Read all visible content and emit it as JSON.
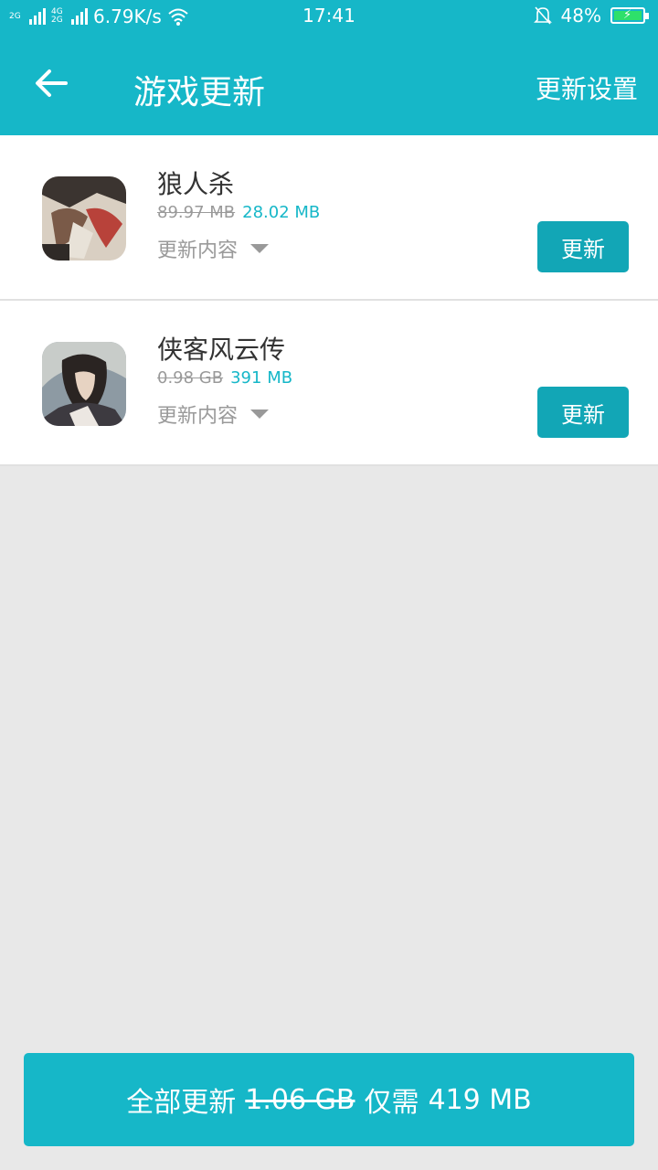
{
  "status_bar": {
    "network_tag_1": "2G",
    "network_tag_2a": "4G",
    "network_tag_2b": "2G",
    "speed": "6.79K/s",
    "time": "17:41",
    "battery": "48%"
  },
  "header": {
    "title": "游戏更新",
    "settings": "更新设置"
  },
  "games": [
    {
      "name": "狼人杀",
      "old_size": "89.97 MB",
      "new_size": "28.02 MB",
      "detail_label": "更新内容",
      "button_label": "更新"
    },
    {
      "name": "侠客风云传",
      "old_size": "0.98 GB",
      "new_size": "391 MB",
      "detail_label": "更新内容",
      "button_label": "更新"
    }
  ],
  "footer": {
    "label": "全部更新",
    "old_total": "1.06 GB",
    "need_label": "仅需",
    "new_total": "419 MB"
  },
  "colors": {
    "accent": "#16b7c8",
    "button": "#12a6b6",
    "battery": "#2ee06a"
  }
}
